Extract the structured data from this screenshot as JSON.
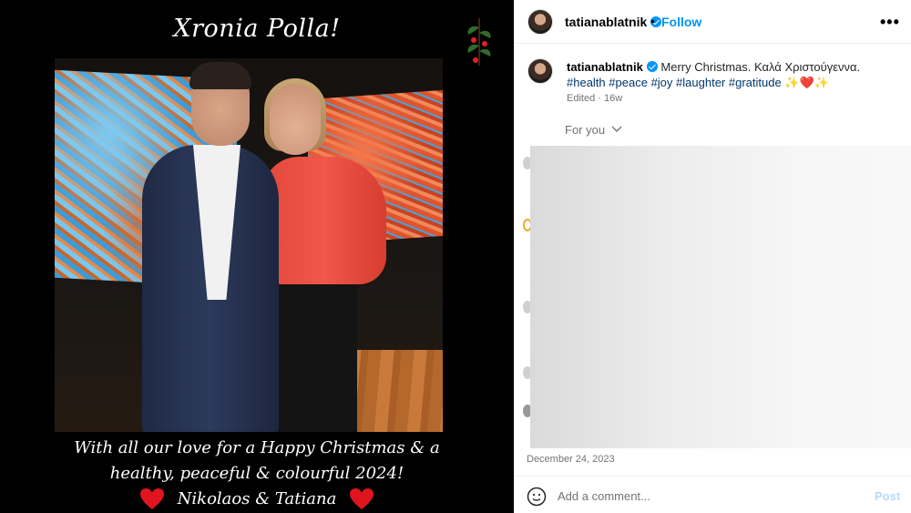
{
  "media": {
    "card_title": "Xronia Polla!",
    "message_line1": "With all our love for a Happy Christmas & a",
    "message_line2": "healthy, peaceful & colourful 2024!",
    "signature": "Nikolaos & Tatiana"
  },
  "post": {
    "username": "tatianablatnik",
    "separator": "•",
    "follow_label": "Follow",
    "more_label": "•••",
    "caption": {
      "username": "tatianablatnik",
      "text": "Merry Christmas. Καλά Χριστούγεννα.",
      "tags": [
        "#health",
        "#peace",
        "#joy",
        "#laughter",
        "#gratitude"
      ],
      "emojis": "✨❤️✨"
    },
    "edited_label": "Edited",
    "age": "16w",
    "for_you_label": "For you",
    "date": "December 24, 2023",
    "comment_placeholder": "Add a comment...",
    "post_label": "Post"
  },
  "colors": {
    "accent": "#0095f6",
    "hashtag": "#00376b",
    "muted": "#737373",
    "post_disabled": "#b3dbff"
  },
  "icons": [
    "holly-icon",
    "heart-icon",
    "verified-badge-icon",
    "chevron-down-icon",
    "more-icon",
    "emoji-icon"
  ]
}
